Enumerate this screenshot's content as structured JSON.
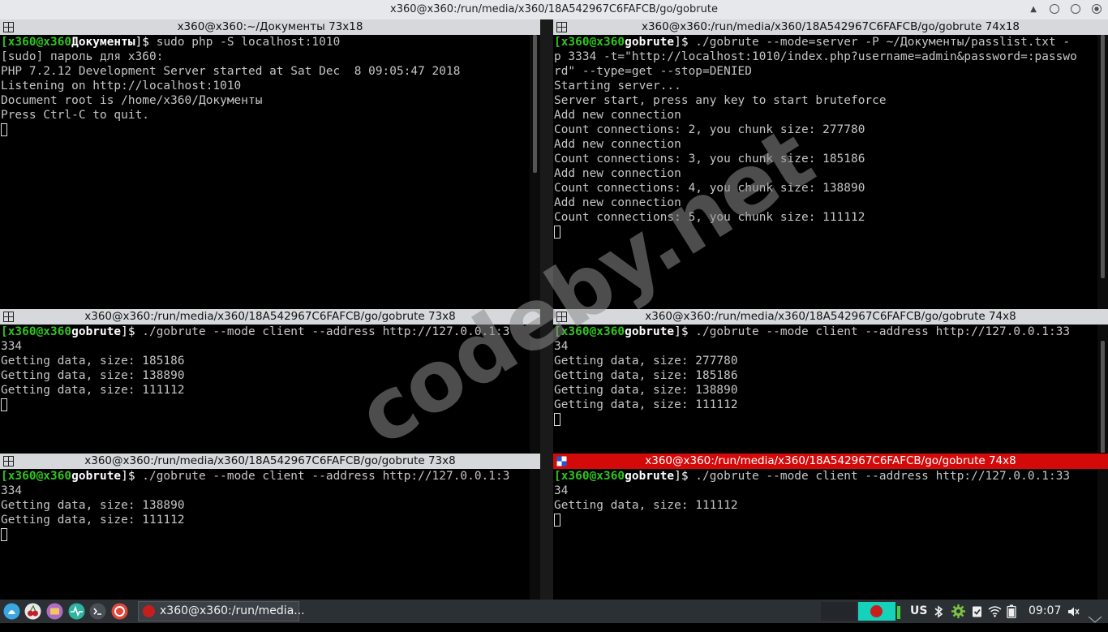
{
  "window": {
    "title": "x360@x360:/run/media/x360/18A542967C6FAFCB/go/gobrute",
    "menu_glyph": "▲"
  },
  "panes": [
    {
      "title": "x360@x360:~/Документы 73x18",
      "active": false,
      "prompt": {
        "user": "[x360@x360",
        "dir": "Документы",
        "sym": "]$",
        "cmd": " sudo php -S localhost:1010"
      },
      "output": [
        "[sudo] пароль для x360:",
        "PHP 7.2.12 Development Server started at Sat Dec  8 09:05:47 2018",
        "Listening on http://localhost:1010",
        "Document root is /home/x360/Документы",
        "Press Ctrl-C to quit."
      ]
    },
    {
      "title": "x360@x360:/run/media/x360/18A542967C6FAFCB/go/gobrute 74x18",
      "active": false,
      "prompt": {
        "user": "[x360@x360",
        "dir": "gobrute",
        "sym": "]$",
        "cmd": " ./gobrute --mode=server -P ~/Документы/passlist.txt -"
      },
      "output": [
        "p 3334 -t=\"http://localhost:1010/index.php?username=admin&password=:passwo",
        "rd\" --type=get --stop=DENIED",
        "Starting server...",
        "Server start, press any key to start bruteforce",
        "Add new connection",
        "Count connections: 2, you chunk size: 277780",
        "Add new connection",
        "Count connections: 3, you chunk size: 185186",
        "Add new connection",
        "Count connections: 4, you chunk size: 138890",
        "Add new connection",
        "Count connections: 5, you chunk size: 111112"
      ]
    },
    {
      "title": "x360@x360:/run/media/x360/18A542967C6FAFCB/go/gobrute 73x8",
      "active": false,
      "prompt": {
        "user": "[x360@x360",
        "dir": "gobrute",
        "sym": "]$",
        "cmd": " ./gobrute --mode client --address http://127.0.0.1:3"
      },
      "output": [
        "334",
        "Getting data, size: 185186",
        "Getting data, size: 138890",
        "Getting data, size: 111112"
      ]
    },
    {
      "title": "x360@x360:/run/media/x360/18A542967C6FAFCB/go/gobrute 74x8",
      "active": false,
      "prompt": {
        "user": "[x360@x360",
        "dir": "gobrute",
        "sym": "]$",
        "cmd": " ./gobrute --mode client --address http://127.0.0.1:33"
      },
      "output": [
        "34",
        "Getting data, size: 277780",
        "Getting data, size: 185186",
        "Getting data, size: 138890",
        "Getting data, size: 111112"
      ]
    },
    {
      "title": "x360@x360:/run/media/x360/18A542967C6FAFCB/go/gobrute 73x8",
      "active": false,
      "prompt": {
        "user": "[x360@x360",
        "dir": "gobrute",
        "sym": "]$",
        "cmd": " ./gobrute --mode client --address http://127.0.0.1:3"
      },
      "output": [
        "334",
        "Getting data, size: 138890",
        "Getting data, size: 111112"
      ]
    },
    {
      "title": "x360@x360:/run/media/x360/18A542967C6FAFCB/go/gobrute 74x8",
      "active": true,
      "prompt": {
        "user": "[x360@x360",
        "dir": "gobrute",
        "sym": "]$",
        "cmd": " ./gobrute --mode client --address http://127.0.0.1:33"
      },
      "output": [
        "34",
        "Getting data, size: 111112"
      ]
    }
  ],
  "watermark": "codeby.net",
  "taskbar": {
    "task_label": "x360@x360:/run/media...",
    "keyboard_layout": "US",
    "clock": "09:07",
    "colors": {
      "panel": "#2b3035",
      "active_workspace": "#15d2bb",
      "active_pane_title": "#d40a0a"
    }
  }
}
